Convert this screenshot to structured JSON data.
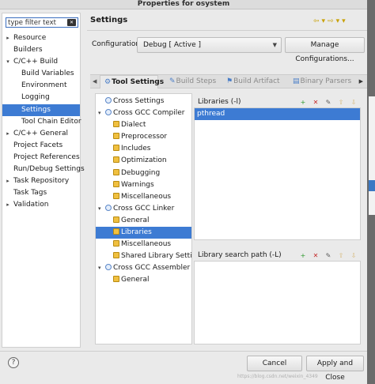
{
  "window": {
    "title": "Properties for osystem"
  },
  "filter": {
    "placeholder": "type filter text"
  },
  "nav_tree": [
    {
      "label": "Resource",
      "level": 0,
      "expander": "▸"
    },
    {
      "label": "Builders",
      "level": 0,
      "expander": ""
    },
    {
      "label": "C/C++ Build",
      "level": 0,
      "expander": "▾"
    },
    {
      "label": "Build Variables",
      "level": 1,
      "expander": ""
    },
    {
      "label": "Environment",
      "level": 1,
      "expander": ""
    },
    {
      "label": "Logging",
      "level": 1,
      "expander": ""
    },
    {
      "label": "Settings",
      "level": 1,
      "expander": "",
      "selected": true
    },
    {
      "label": "Tool Chain Editor",
      "level": 1,
      "expander": ""
    },
    {
      "label": "C/C++ General",
      "level": 0,
      "expander": "▸"
    },
    {
      "label": "Project Facets",
      "level": 0,
      "expander": ""
    },
    {
      "label": "Project References",
      "level": 0,
      "expander": ""
    },
    {
      "label": "Run/Debug Settings",
      "level": 0,
      "expander": ""
    },
    {
      "label": "Task Repository",
      "level": 0,
      "expander": "▸"
    },
    {
      "label": "Task Tags",
      "level": 0,
      "expander": ""
    },
    {
      "label": "Validation",
      "level": 0,
      "expander": "▸"
    }
  ],
  "header": {
    "title": "Settings",
    "nav_icons": "⇦▾⇨▾▾"
  },
  "configuration": {
    "label": "Configuration:",
    "selected": "Debug  [ Active ]",
    "manage_button": "Manage Configurations..."
  },
  "tabs": {
    "items": [
      {
        "label": "Tool Settings",
        "icon": "⚙",
        "active": true
      },
      {
        "label": "Build Steps",
        "icon": "✎",
        "active": false
      },
      {
        "label": "Build Artifact",
        "icon": "⚑",
        "active": false
      },
      {
        "label": "Binary Parsers",
        "icon": "▤",
        "active": false
      }
    ],
    "arrow_left": "◀",
    "arrow_right": "▶"
  },
  "tool_tree": [
    {
      "label": "Cross Settings",
      "level": 0,
      "expander": "",
      "icon": "cfg"
    },
    {
      "label": "Cross GCC Compiler",
      "level": 0,
      "expander": "▾",
      "icon": "cfg"
    },
    {
      "label": "Dialect",
      "level": 1,
      "expander": "",
      "icon": "opt"
    },
    {
      "label": "Preprocessor",
      "level": 1,
      "expander": "",
      "icon": "opt"
    },
    {
      "label": "Includes",
      "level": 1,
      "expander": "",
      "icon": "opt"
    },
    {
      "label": "Optimization",
      "level": 1,
      "expander": "",
      "icon": "opt"
    },
    {
      "label": "Debugging",
      "level": 1,
      "expander": "",
      "icon": "opt"
    },
    {
      "label": "Warnings",
      "level": 1,
      "expander": "",
      "icon": "opt"
    },
    {
      "label": "Miscellaneous",
      "level": 1,
      "expander": "",
      "icon": "opt"
    },
    {
      "label": "Cross GCC Linker",
      "level": 0,
      "expander": "▾",
      "icon": "cfg"
    },
    {
      "label": "General",
      "level": 1,
      "expander": "",
      "icon": "opt"
    },
    {
      "label": "Libraries",
      "level": 1,
      "expander": "",
      "icon": "opt",
      "selected": true
    },
    {
      "label": "Miscellaneous",
      "level": 1,
      "expander": "",
      "icon": "opt"
    },
    {
      "label": "Shared Library Settings",
      "level": 1,
      "expander": "",
      "icon": "opt"
    },
    {
      "label": "Cross GCC Assembler",
      "level": 0,
      "expander": "▾",
      "icon": "cfg"
    },
    {
      "label": "General",
      "level": 1,
      "expander": "",
      "icon": "opt"
    }
  ],
  "libraries": {
    "header": "Libraries (-l)",
    "items": [
      "pthread"
    ]
  },
  "search_path": {
    "header": "Library search path (-L)",
    "items": []
  },
  "list_toolbar": {
    "add": "+",
    "delete": "✕",
    "edit": "✎",
    "up": "⇧",
    "down": "⇩"
  },
  "footer": {
    "help_icon": "?",
    "cancel": "Cancel",
    "apply_close": "Apply and Close",
    "watermark": "https://blog.csdn.net/weixin_4349"
  }
}
